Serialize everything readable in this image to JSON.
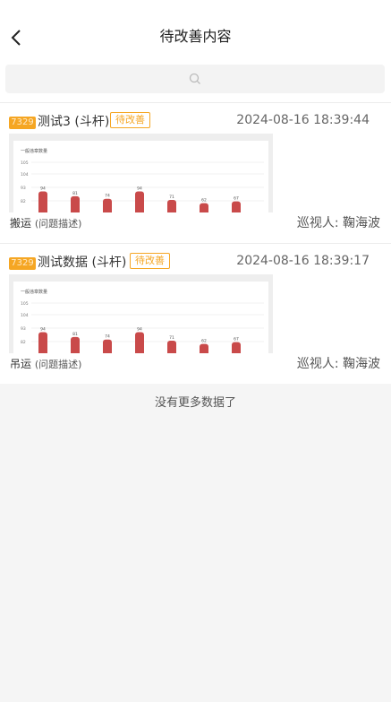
{
  "header": {
    "title": "待改善内容"
  },
  "search": {
    "placeholder": ""
  },
  "items": [
    {
      "number": "7329",
      "title": "测试3 (斗杆)",
      "status": "待改善",
      "datetime": "2024-08-16 18:39:44",
      "category": "搬运",
      "category_note": "(问题描述)",
      "inspector": "巡视人: 鞠海波",
      "thumbnail": {
        "chart_title": "一般违章数量",
        "y_ticks": [
          "105",
          "104",
          "93",
          "82"
        ],
        "bar_labels": [
          "94",
          "81",
          "74",
          "94",
          "71",
          "62",
          "67"
        ],
        "values": [
          94,
          81,
          74,
          94,
          71,
          62,
          67
        ]
      }
    },
    {
      "number": "7329",
      "title": "测试数据 (斗杆)",
      "status": "待改善",
      "datetime": "2024-08-16 18:39:17",
      "category": "吊运",
      "category_note": "(问题描述)",
      "inspector": "巡视人: 鞠海波",
      "thumbnail": {
        "chart_title": "一般违章数量",
        "y_ticks": [
          "105",
          "104",
          "93",
          "82"
        ],
        "bar_labels": [
          "94",
          "81",
          "74",
          "94",
          "71",
          "62",
          "67"
        ],
        "values": [
          94,
          81,
          74,
          94,
          71,
          62,
          67
        ]
      }
    }
  ],
  "footer": {
    "no_more": "没有更多数据了"
  },
  "colors": {
    "accent": "#f5a623",
    "bar": "#c94a4a"
  }
}
